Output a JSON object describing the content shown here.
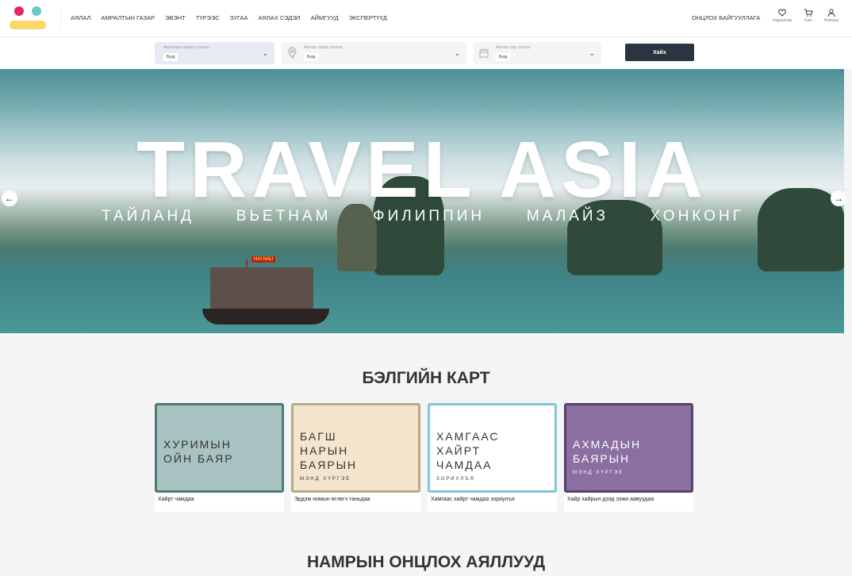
{
  "nav": {
    "items": [
      "АЯЛАЛ",
      "АМРАЛТЫН ГАЗАР",
      "ЭВЭНТ",
      "ТҮРЭЭС",
      "ЗУГАА",
      "АЯЛАХ СЭДЭЛ",
      "АЙМГУУД",
      "ЭКСПЕРТҮҮД"
    ],
    "featured": "ОНЦЛОХ БАЙГУУЛЛАГА",
    "saved": "Хадгалсан",
    "cart": "Сагс",
    "login": "Нэвтрэх"
  },
  "search": {
    "type_ph": "Аялалын төрөл сонгох",
    "place_ph": "Аялах газар сонгох",
    "month_ph": "Аялах сар сонгох",
    "value": "Бүгд",
    "button": "Хайх"
  },
  "hero": {
    "title": "TRAVEL ASIA",
    "countries": [
      "ТАЙЛАНД",
      "ВЬЕТНАМ",
      "ФИЛИППИН",
      "МАЛАЙЗ",
      "ХОНКОНГ"
    ],
    "boat_sign": "HAI NAU"
  },
  "gift": {
    "title": "БЭЛГИЙН КАРТ",
    "cards": [
      {
        "l1": "ХУРИМЫН",
        "l2": "ОЙН БАЯР",
        "l3": "",
        "small": "",
        "caption": "Хайрт чамдаа",
        "bg": "#a9c3c3",
        "border": "#4d7a72"
      },
      {
        "l1": "БАГШ",
        "l2": "НАРЫН",
        "l3": "БАЯРЫН",
        "small": "МЭНД ХҮРГЭЕ",
        "caption": "Эрдэм номын өглөгч таньдаа",
        "bg": "#f3e6cc",
        "border": "#b9aa85"
      },
      {
        "l1": "ХАМГААС",
        "l2": "ХАЙРТ",
        "l3": "ЧАМДАА",
        "small": "ЗОРИУЛЪЯ",
        "caption": "Хамгаас хайрт чамдаа зориулъя",
        "bg": "#ffffff",
        "border": "#7fc6dc"
      },
      {
        "l1": "АХМАДЫН",
        "l2": "БАЯРЫН",
        "l3": "",
        "small": "МЭНД ХҮРГЭЕ",
        "caption": "Хайр хайрын дээд ээжи аавуудаа",
        "bg": "#8b6fa0",
        "border": "#5a3f70"
      }
    ]
  },
  "summer": {
    "title": "НАМРЫН ОНЦЛОХ АЯЛЛУУД"
  }
}
